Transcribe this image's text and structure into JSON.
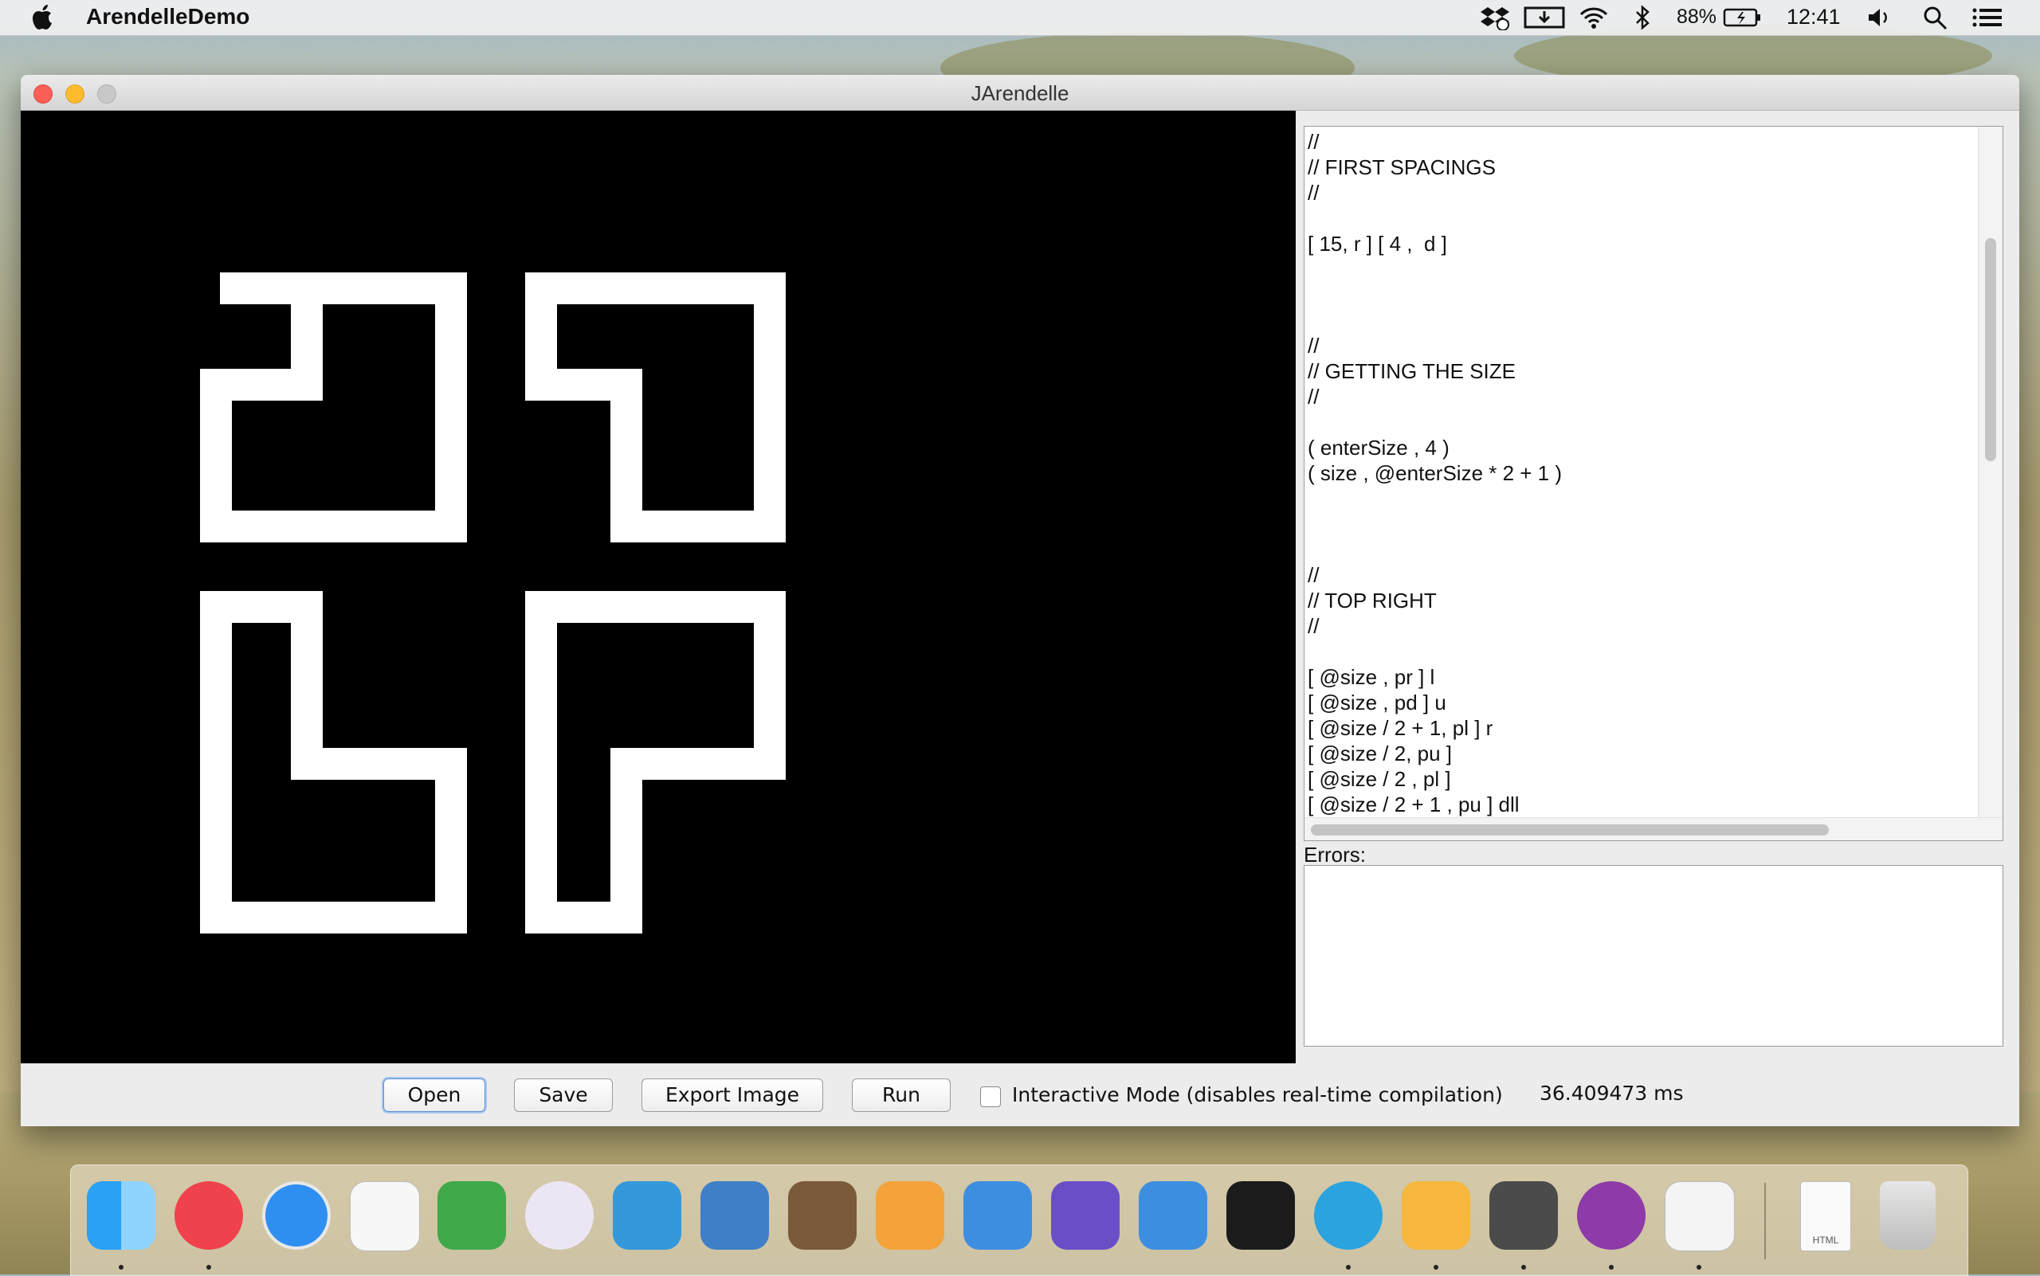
{
  "menubar": {
    "app_name": "ArendelleDemo",
    "battery": "88%",
    "clock": "12:41",
    "icons": [
      "apple-icon",
      "dropbox-icon",
      "download-icon",
      "wifi-icon",
      "bluetooth-icon",
      "battery-icon",
      "volume-icon",
      "spotlight-icon",
      "notification-center-icon"
    ]
  },
  "window": {
    "title": "JArendelle",
    "code_lines": [
      "//",
      "// FIRST SPACINGS",
      "//",
      "",
      "[ 15, r ] [ 4 ,  d ]",
      "",
      "",
      "",
      "//",
      "// GETTING THE SIZE",
      "//",
      "",
      "( enterSize , 4 )",
      "( size , @enterSize * 2 + 1 )",
      "",
      "",
      "",
      "//",
      "// TOP RIGHT",
      "//",
      "",
      "[ @size , pr ] l",
      "[ @size , pd ] u",
      "[ @size / 2 + 1, pl ] r",
      "[ @size / 2, pu ]",
      "[ @size / 2 , pl ]",
      "[ @size / 2 + 1 , pu ] dll"
    ],
    "errors_label": "Errors:",
    "errors_text": "",
    "buttons": {
      "open": "Open",
      "save": "Save",
      "export": "Export Image",
      "run": "Run"
    },
    "interactive_mode_label": "Interactive Mode (disables real-time compilation)",
    "interactive_mode_checked": false,
    "timing": "36.409473 ms"
  },
  "dock": {
    "apps": [
      "Finder",
      "iTunes",
      "Safari",
      "Writer",
      "Evernote",
      "GitHub",
      "Xamarin",
      "Circuit",
      "GarageBand",
      "Pages",
      "Keynote",
      "iMovie",
      "Xcode",
      "Terminal",
      "Telegram",
      "Sketch",
      "Sublime Text",
      "Pigeon",
      "Java",
      "HTML file",
      "Trash"
    ],
    "html_doc_label": "HTML"
  },
  "colors": {
    "canvas_bg": "#000000",
    "shape_stroke": "#ffffff",
    "window_bg": "#ececec",
    "close": "#fc5f57",
    "minimize": "#fdbc2e",
    "zoom": "#c8c8c8"
  }
}
